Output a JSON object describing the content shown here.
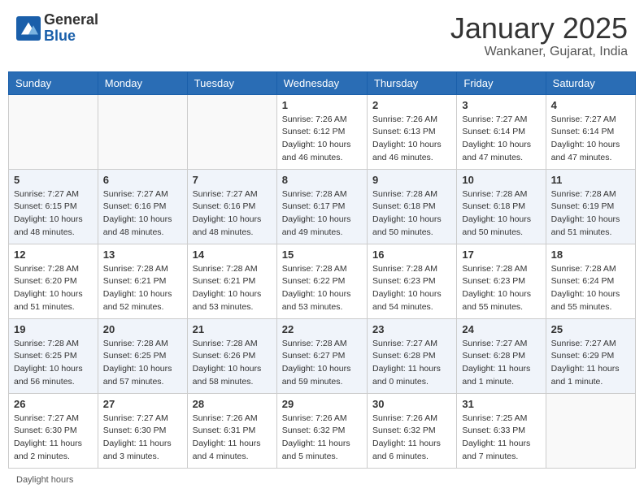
{
  "header": {
    "logo_general": "General",
    "logo_blue": "Blue",
    "month_title": "January 2025",
    "subtitle": "Wankaner, Gujarat, India"
  },
  "days_of_week": [
    "Sunday",
    "Monday",
    "Tuesday",
    "Wednesday",
    "Thursday",
    "Friday",
    "Saturday"
  ],
  "weeks": [
    {
      "days": [
        {
          "number": "",
          "info": ""
        },
        {
          "number": "",
          "info": ""
        },
        {
          "number": "",
          "info": ""
        },
        {
          "number": "1",
          "info": "Sunrise: 7:26 AM\nSunset: 6:12 PM\nDaylight: 10 hours\nand 46 minutes."
        },
        {
          "number": "2",
          "info": "Sunrise: 7:26 AM\nSunset: 6:13 PM\nDaylight: 10 hours\nand 46 minutes."
        },
        {
          "number": "3",
          "info": "Sunrise: 7:27 AM\nSunset: 6:14 PM\nDaylight: 10 hours\nand 47 minutes."
        },
        {
          "number": "4",
          "info": "Sunrise: 7:27 AM\nSunset: 6:14 PM\nDaylight: 10 hours\nand 47 minutes."
        }
      ]
    },
    {
      "days": [
        {
          "number": "5",
          "info": "Sunrise: 7:27 AM\nSunset: 6:15 PM\nDaylight: 10 hours\nand 48 minutes."
        },
        {
          "number": "6",
          "info": "Sunrise: 7:27 AM\nSunset: 6:16 PM\nDaylight: 10 hours\nand 48 minutes."
        },
        {
          "number": "7",
          "info": "Sunrise: 7:27 AM\nSunset: 6:16 PM\nDaylight: 10 hours\nand 48 minutes."
        },
        {
          "number": "8",
          "info": "Sunrise: 7:28 AM\nSunset: 6:17 PM\nDaylight: 10 hours\nand 49 minutes."
        },
        {
          "number": "9",
          "info": "Sunrise: 7:28 AM\nSunset: 6:18 PM\nDaylight: 10 hours\nand 50 minutes."
        },
        {
          "number": "10",
          "info": "Sunrise: 7:28 AM\nSunset: 6:18 PM\nDaylight: 10 hours\nand 50 minutes."
        },
        {
          "number": "11",
          "info": "Sunrise: 7:28 AM\nSunset: 6:19 PM\nDaylight: 10 hours\nand 51 minutes."
        }
      ]
    },
    {
      "days": [
        {
          "number": "12",
          "info": "Sunrise: 7:28 AM\nSunset: 6:20 PM\nDaylight: 10 hours\nand 51 minutes."
        },
        {
          "number": "13",
          "info": "Sunrise: 7:28 AM\nSunset: 6:21 PM\nDaylight: 10 hours\nand 52 minutes."
        },
        {
          "number": "14",
          "info": "Sunrise: 7:28 AM\nSunset: 6:21 PM\nDaylight: 10 hours\nand 53 minutes."
        },
        {
          "number": "15",
          "info": "Sunrise: 7:28 AM\nSunset: 6:22 PM\nDaylight: 10 hours\nand 53 minutes."
        },
        {
          "number": "16",
          "info": "Sunrise: 7:28 AM\nSunset: 6:23 PM\nDaylight: 10 hours\nand 54 minutes."
        },
        {
          "number": "17",
          "info": "Sunrise: 7:28 AM\nSunset: 6:23 PM\nDaylight: 10 hours\nand 55 minutes."
        },
        {
          "number": "18",
          "info": "Sunrise: 7:28 AM\nSunset: 6:24 PM\nDaylight: 10 hours\nand 55 minutes."
        }
      ]
    },
    {
      "days": [
        {
          "number": "19",
          "info": "Sunrise: 7:28 AM\nSunset: 6:25 PM\nDaylight: 10 hours\nand 56 minutes."
        },
        {
          "number": "20",
          "info": "Sunrise: 7:28 AM\nSunset: 6:25 PM\nDaylight: 10 hours\nand 57 minutes."
        },
        {
          "number": "21",
          "info": "Sunrise: 7:28 AM\nSunset: 6:26 PM\nDaylight: 10 hours\nand 58 minutes."
        },
        {
          "number": "22",
          "info": "Sunrise: 7:28 AM\nSunset: 6:27 PM\nDaylight: 10 hours\nand 59 minutes."
        },
        {
          "number": "23",
          "info": "Sunrise: 7:27 AM\nSunset: 6:28 PM\nDaylight: 11 hours\nand 0 minutes."
        },
        {
          "number": "24",
          "info": "Sunrise: 7:27 AM\nSunset: 6:28 PM\nDaylight: 11 hours\nand 1 minute."
        },
        {
          "number": "25",
          "info": "Sunrise: 7:27 AM\nSunset: 6:29 PM\nDaylight: 11 hours\nand 1 minute."
        }
      ]
    },
    {
      "days": [
        {
          "number": "26",
          "info": "Sunrise: 7:27 AM\nSunset: 6:30 PM\nDaylight: 11 hours\nand 2 minutes."
        },
        {
          "number": "27",
          "info": "Sunrise: 7:27 AM\nSunset: 6:30 PM\nDaylight: 11 hours\nand 3 minutes."
        },
        {
          "number": "28",
          "info": "Sunrise: 7:26 AM\nSunset: 6:31 PM\nDaylight: 11 hours\nand 4 minutes."
        },
        {
          "number": "29",
          "info": "Sunrise: 7:26 AM\nSunset: 6:32 PM\nDaylight: 11 hours\nand 5 minutes."
        },
        {
          "number": "30",
          "info": "Sunrise: 7:26 AM\nSunset: 6:32 PM\nDaylight: 11 hours\nand 6 minutes."
        },
        {
          "number": "31",
          "info": "Sunrise: 7:25 AM\nSunset: 6:33 PM\nDaylight: 11 hours\nand 7 minutes."
        },
        {
          "number": "",
          "info": ""
        }
      ]
    }
  ],
  "footer": {
    "daylight_label": "Daylight hours"
  }
}
